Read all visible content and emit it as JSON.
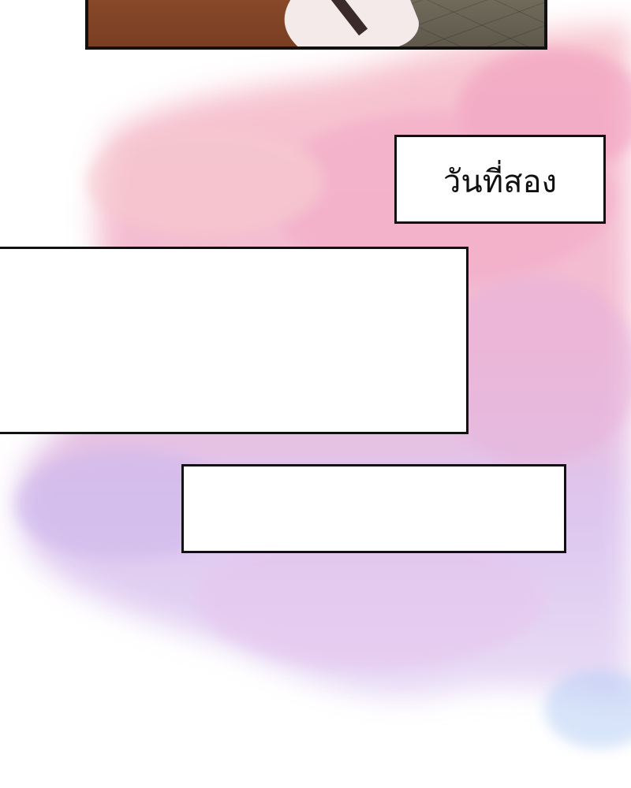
{
  "captions": {
    "day_label": "วันที่สอง",
    "empty_box_1": "",
    "empty_box_2": ""
  },
  "colors": {
    "blossom_pink": "#f4b8cc",
    "blossom_lilac": "#d9c4ef",
    "blossom_blue": "#c9d8f6",
    "box_border": "#111111"
  }
}
